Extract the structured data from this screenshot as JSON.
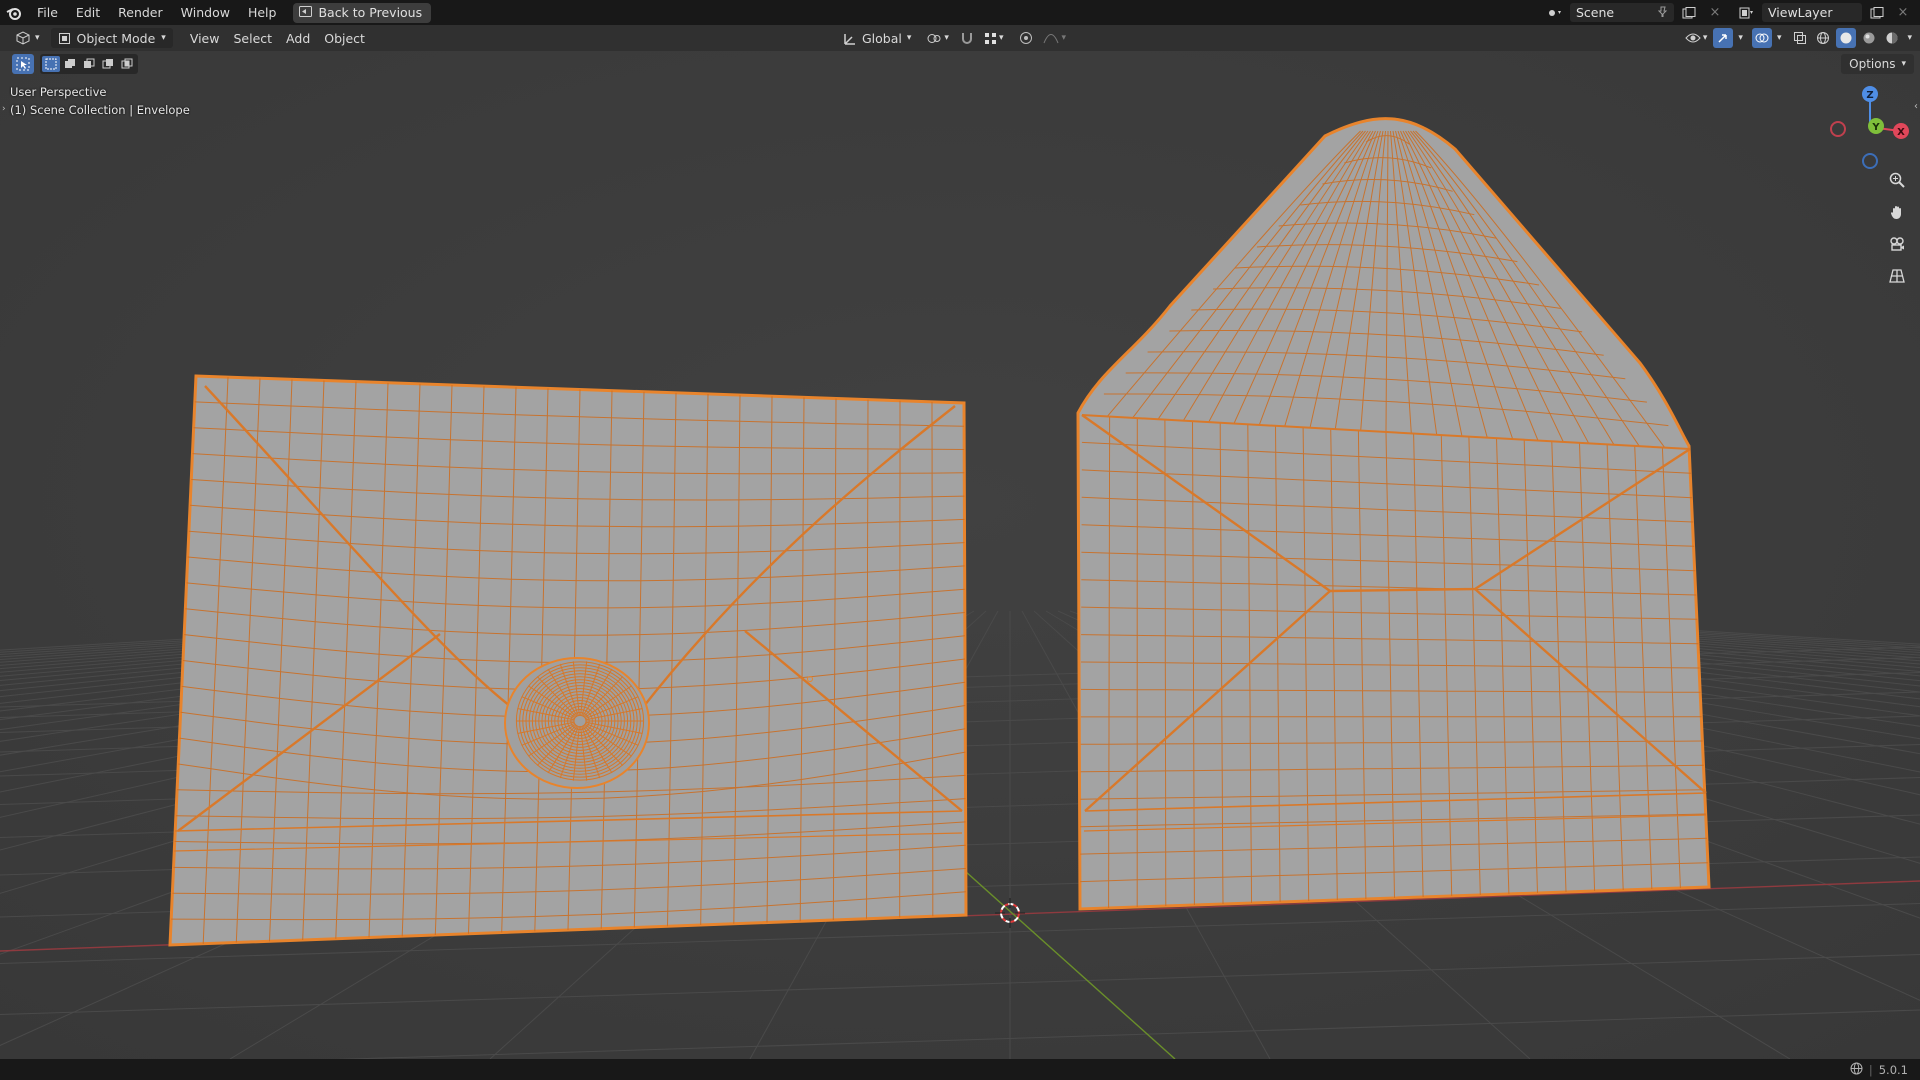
{
  "app": {
    "menu": [
      "File",
      "Edit",
      "Render",
      "Window",
      "Help"
    ],
    "back_button": "Back to Previous",
    "scene": "Scene",
    "view_layer": "ViewLayer"
  },
  "viewport_header": {
    "mode": "Object Mode",
    "menus": [
      "View",
      "Select",
      "Add",
      "Object"
    ],
    "transform_orientation": "Global"
  },
  "viewport": {
    "view_name": "User Perspective",
    "collection_info": "(1) Scene Collection | Envelope",
    "options_label": "Options",
    "gizmo": {
      "z": "Z",
      "x": "X",
      "y": "Y"
    }
  },
  "status": {
    "version": "5.0.1"
  },
  "colors": {
    "wire": "#e8842c",
    "mesh_fill": "#a3a3a3",
    "viewport_bg": "#3d3d3d",
    "accent": "#4772b3"
  }
}
